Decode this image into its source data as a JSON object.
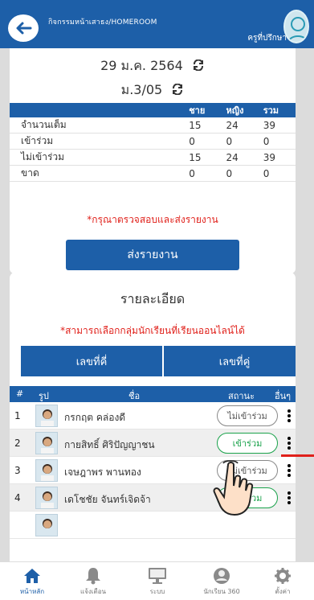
{
  "header": {
    "title": "กิจกรรมหน้าเสาธง/HOMEROOM",
    "role": "ครูที่ปรึกษา"
  },
  "summary": {
    "date": "29 ม.ค. 2564",
    "class": "ม.3/05",
    "columns": [
      "ชาย",
      "หญิง",
      "รวม"
    ],
    "rows": [
      {
        "label": "จำนวนเต็ม",
        "values": [
          "15",
          "24",
          "39"
        ]
      },
      {
        "label": "เข้าร่วม",
        "values": [
          "0",
          "0",
          "0"
        ]
      },
      {
        "label": "ไม่เข้าร่วม",
        "values": [
          "15",
          "24",
          "39"
        ]
      },
      {
        "label": "ขาด",
        "values": [
          "0",
          "0",
          "0"
        ]
      }
    ],
    "warning": "*กรุณาตรวจสอบและส่งรายงาน",
    "send_button": "ส่งรายงาน"
  },
  "details": {
    "title": "รายละเอียด",
    "warning": "*สามารถเลือกกลุ่มนักเรียนที่เรียนออนไลน์ได้",
    "odd_button": "เลขที่คี่",
    "even_button": "เลขที่คู่",
    "table_headers": {
      "no": "#",
      "photo": "รูป",
      "name": "ชื่อ",
      "status": "สถานะ",
      "more": "อื่นๆ"
    },
    "students": [
      {
        "no": "1",
        "name": "กรกฤต คล่องดี",
        "status": "ไม่เข้าร่วม"
      },
      {
        "no": "2",
        "name": "กายสิทธิ์ ศิริปัญญาชน",
        "status": "เข้าร่วม"
      },
      {
        "no": "3",
        "name": "เจษฎาพร พานทอง",
        "status": "ไม่เข้าร่วม"
      },
      {
        "no": "4",
        "name": "เดโชชัย จันทร์เจิดจ้า",
        "status": "เข้าร่วม"
      }
    ]
  },
  "nav": {
    "home": "หน้าหลัก",
    "notify": "แจ้งเตือน",
    "system": "ระบบ",
    "student360": "นักเรียน 360",
    "settings": "ตั้งค่า"
  },
  "colors": {
    "primary": "#1d5fa8",
    "present": "#1aa24b",
    "alert": "#e0201a"
  }
}
